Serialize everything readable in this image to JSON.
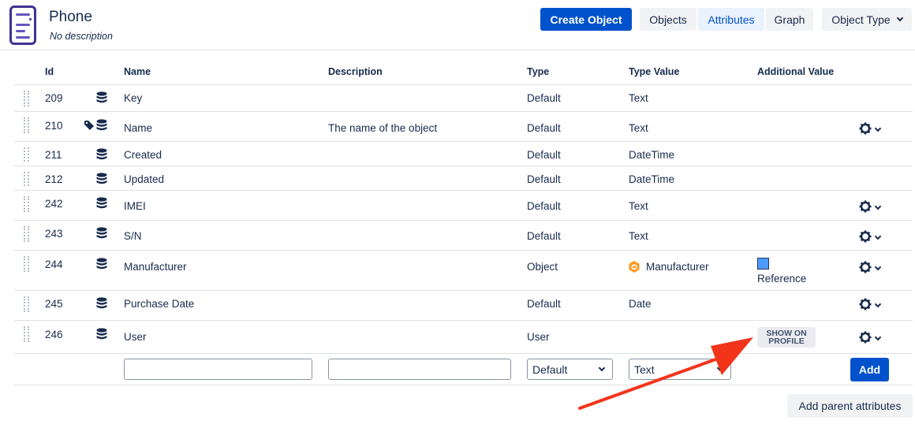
{
  "header": {
    "title": "Phone",
    "subtitle": "No description",
    "icon": "phone-icon",
    "create_label": "Create Object",
    "tabs": [
      {
        "label": "Objects",
        "selected": false
      },
      {
        "label": "Attributes",
        "selected": true
      },
      {
        "label": "Graph",
        "selected": false
      }
    ],
    "object_type_label": "Object Type"
  },
  "table": {
    "columns": [
      "Id",
      "Name",
      "Description",
      "Type",
      "Type Value",
      "Additional Value"
    ],
    "rows": [
      {
        "id": "209",
        "name": "Key",
        "description": "",
        "type": "Default",
        "type_value": "Text",
        "label_attr": false,
        "gear": false
      },
      {
        "id": "210",
        "name": "Name",
        "description": "The name of the object",
        "type": "Default",
        "type_value": "Text",
        "label_attr": true,
        "gear": true
      },
      {
        "id": "211",
        "name": "Created",
        "description": "",
        "type": "Default",
        "type_value": "DateTime",
        "label_attr": false,
        "gear": false
      },
      {
        "id": "212",
        "name": "Updated",
        "description": "",
        "type": "Default",
        "type_value": "DateTime",
        "label_attr": false,
        "gear": false
      },
      {
        "id": "242",
        "name": "IMEI",
        "description": "",
        "type": "Default",
        "type_value": "Text",
        "label_attr": false,
        "gear": true
      },
      {
        "id": "243",
        "name": "S/N",
        "description": "",
        "type": "Default",
        "type_value": "Text",
        "label_attr": false,
        "gear": true
      },
      {
        "id": "244",
        "name": "Manufacturer",
        "description": "",
        "type": "Object",
        "type_value": "Manufacturer",
        "type_value_icon": "object-type-icon",
        "additional": "Reference",
        "additional_color": "#4c9aff",
        "gear": true
      },
      {
        "id": "245",
        "name": "Purchase Date",
        "description": "",
        "type": "Default",
        "type_value": "Date",
        "label_attr": false,
        "gear": true
      },
      {
        "id": "246",
        "name": "User",
        "description": "",
        "type": "User",
        "type_value": "",
        "additional_badge": "SHOW ON PROFILE",
        "gear": true
      }
    ]
  },
  "new_row": {
    "name_value": "",
    "description_value": "",
    "type_selected": "Default",
    "type_value_selected": "Text",
    "add_label": "Add"
  },
  "footer": {
    "add_parent_label": "Add parent attributes"
  },
  "colors": {
    "primary": "#0052cc",
    "annotation_arrow": "#f2341b",
    "icon_purple": "#403294",
    "object_icon_orange": "#ff991f"
  }
}
